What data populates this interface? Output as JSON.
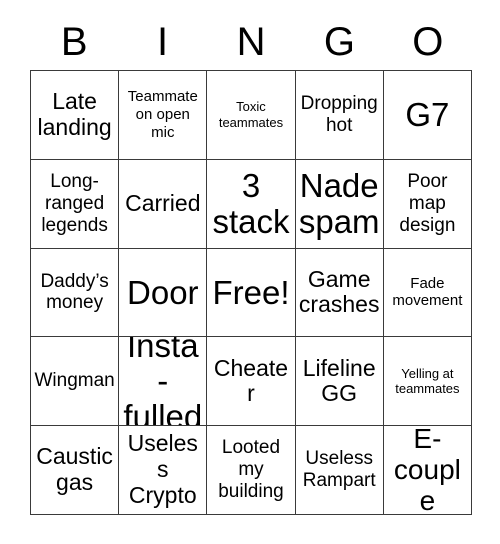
{
  "header": {
    "letters": [
      "B",
      "I",
      "N",
      "G",
      "O"
    ]
  },
  "grid": {
    "columns": 5,
    "rows": 5,
    "free_space_label": "Free!",
    "cells": [
      {
        "text": "Late landing",
        "size": "lg"
      },
      {
        "text": "Teammate on open mic",
        "size": "sm"
      },
      {
        "text": "Toxic teammates",
        "size": "xs"
      },
      {
        "text": "Dropping hot",
        "size": "md"
      },
      {
        "text": "G7",
        "size": "xxl"
      },
      {
        "text": "Long-ranged legends",
        "size": "md"
      },
      {
        "text": "Carried",
        "size": "lg"
      },
      {
        "text": "3 stack",
        "size": "xxl"
      },
      {
        "text": "Nade spam",
        "size": "xxl"
      },
      {
        "text": "Poor map design",
        "size": "md"
      },
      {
        "text": "Daddy’s money",
        "size": "md"
      },
      {
        "text": "Door",
        "size": "xxl"
      },
      {
        "text": "Free!",
        "size": "xxl"
      },
      {
        "text": "Game crashes",
        "size": "lg"
      },
      {
        "text": "Fade movement",
        "size": "sm"
      },
      {
        "text": "Wingman",
        "size": "md"
      },
      {
        "text": "Insta-fulled",
        "size": "xxl"
      },
      {
        "text": "Cheater",
        "size": "lg"
      },
      {
        "text": "Lifeline GG",
        "size": "lg"
      },
      {
        "text": "Yelling at teammates",
        "size": "xs"
      },
      {
        "text": "Caustic gas",
        "size": "lg"
      },
      {
        "text": "Useless Crypto",
        "size": "lg"
      },
      {
        "text": "Looted my building",
        "size": "md"
      },
      {
        "text": "Useless Rampart",
        "size": "md"
      },
      {
        "text": "E-couple",
        "size": "xl"
      }
    ]
  },
  "colors": {
    "background": "#ffffff",
    "text": "#000000",
    "border": "#3a3a3a"
  }
}
